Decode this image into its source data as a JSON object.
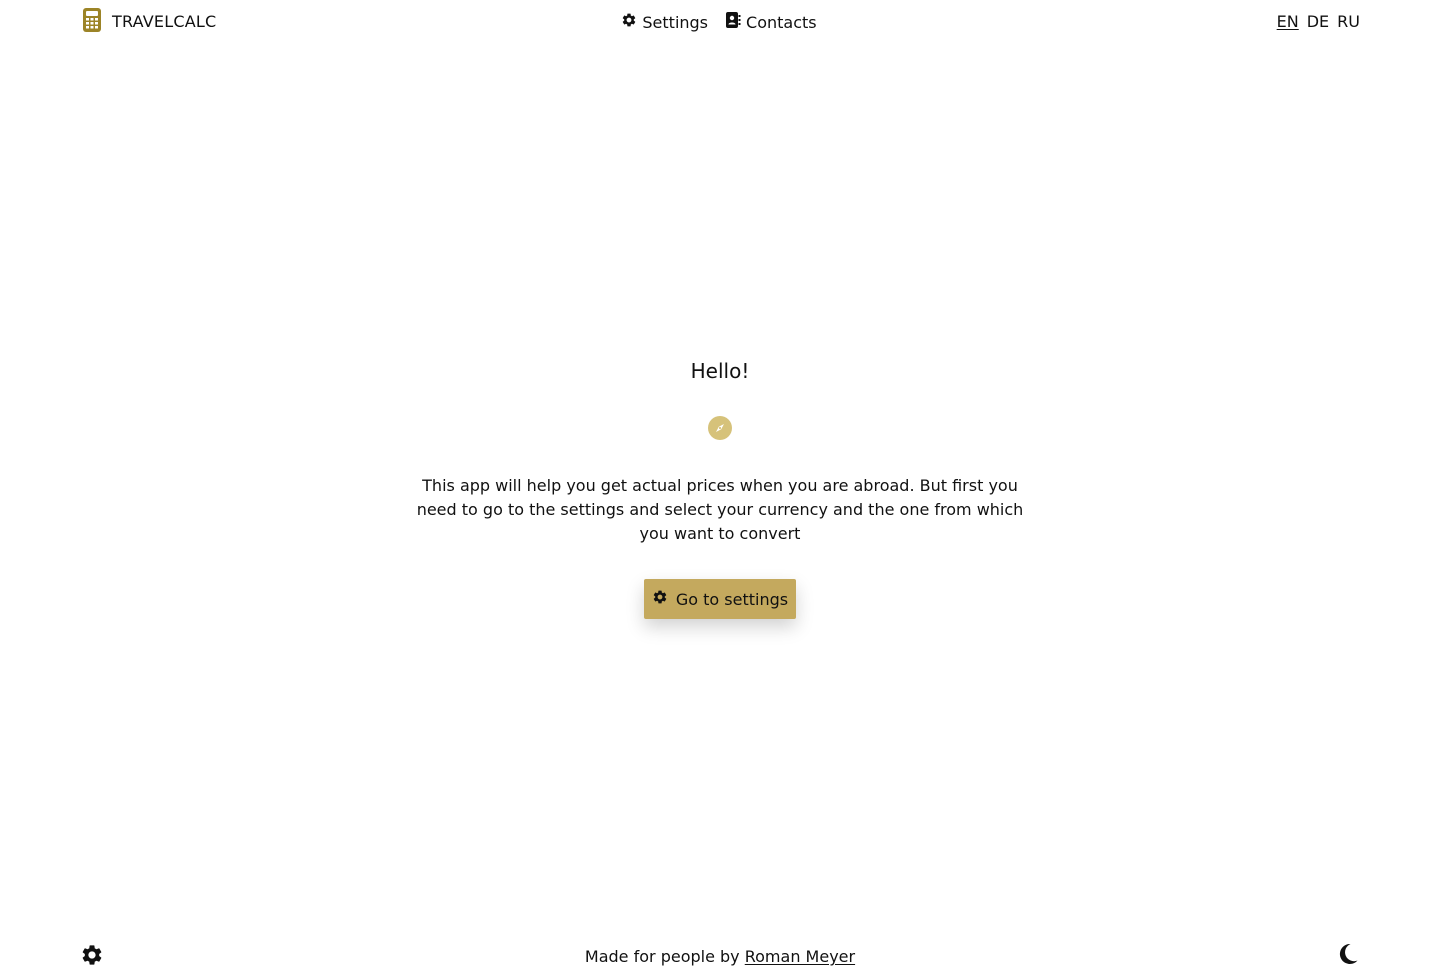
{
  "header": {
    "brand_title": "TRAVELCALC",
    "brand_icon": "calculator-icon",
    "nav": [
      {
        "label": "Settings",
        "icon": "gear-icon"
      },
      {
        "label": "Contacts",
        "icon": "address-book-icon"
      }
    ],
    "languages": [
      "EN",
      "DE",
      "RU"
    ],
    "active_language": "EN"
  },
  "main": {
    "greeting": "Hello!",
    "icon": "compass-icon",
    "description": "This app will help you get actual prices when you are abroad. But first you need to go to the settings and select your currency and the one from which you want to convert",
    "cta_label": "Go to settings",
    "cta_icon": "gear-icon"
  },
  "footer": {
    "prefix": "Made for people by",
    "author": "Roman Meyer",
    "left_icon": "gear-icon",
    "right_icon": "moon-icon"
  },
  "colors": {
    "accent": "#c4a95e",
    "brand_icon": "#9c8427",
    "compass_bg": "#d6c27a",
    "text": "#111111"
  }
}
